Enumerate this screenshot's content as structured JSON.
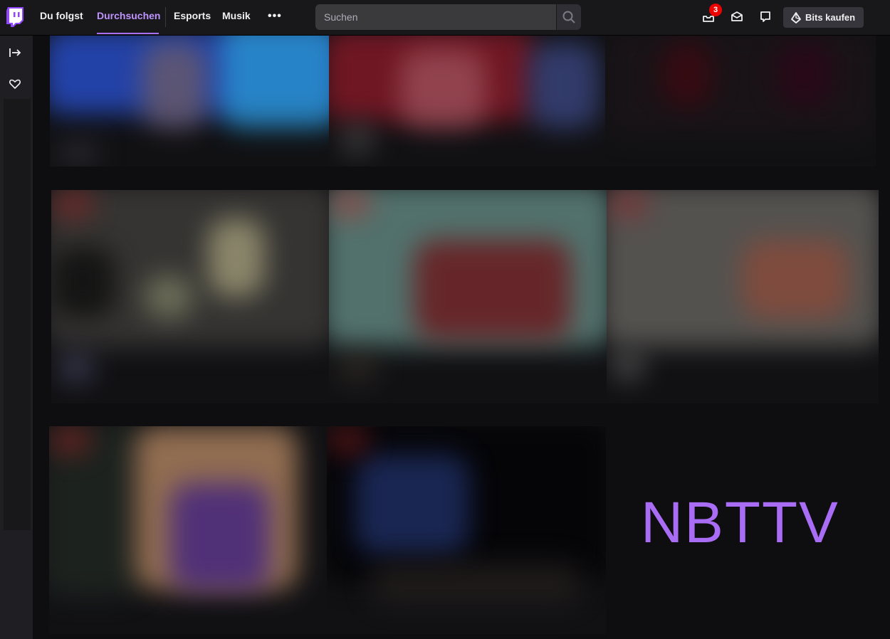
{
  "topbar": {
    "nav": [
      {
        "label": "Du folgst"
      },
      {
        "label": "Durchsuchen"
      },
      {
        "label": "Esports"
      },
      {
        "label": "Musik"
      }
    ],
    "more_label": "•••",
    "search": {
      "placeholder": "Suchen"
    },
    "notifications_count": "3",
    "bits_label": "Bits kaufen"
  },
  "watermark": "NBTTV",
  "colors": {
    "accent": "#a970ff",
    "badge": "#eb0400",
    "background": "#0e0e10"
  }
}
